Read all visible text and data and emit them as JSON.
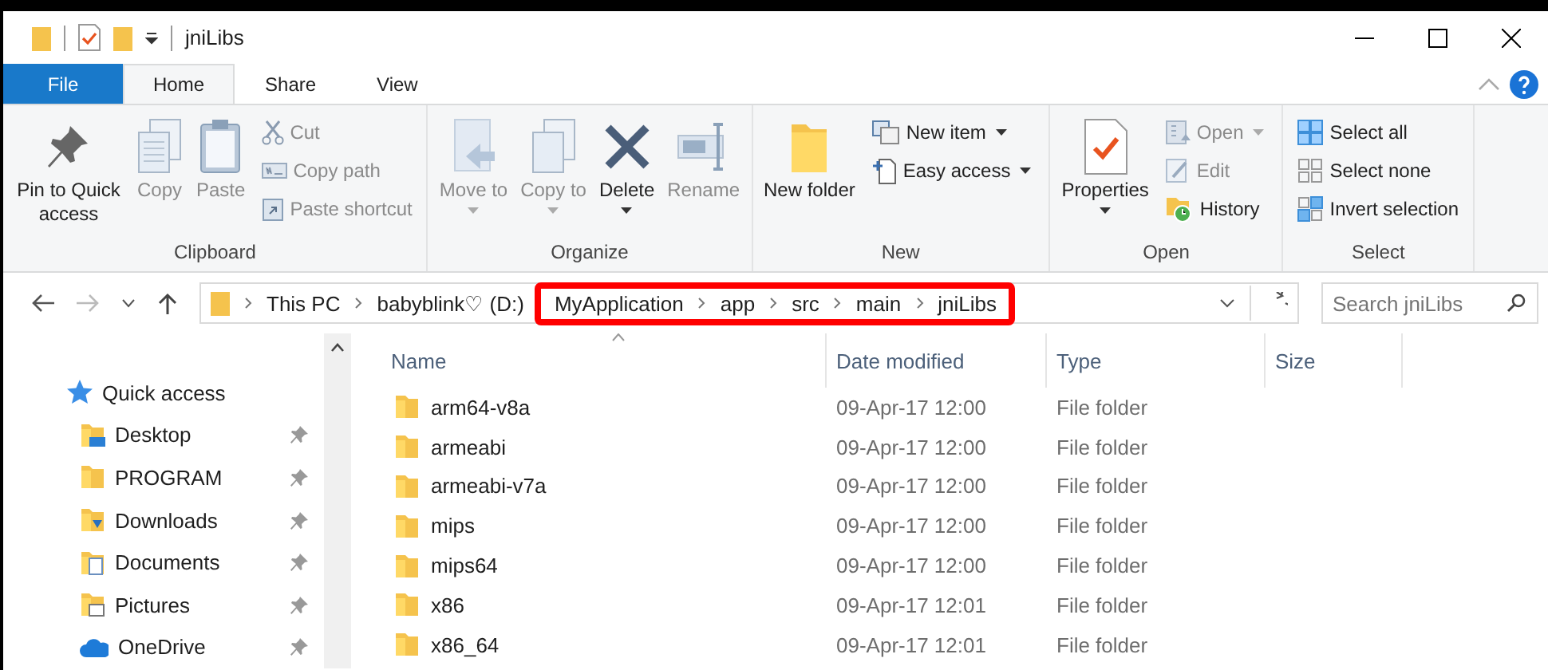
{
  "window": {
    "title": "jniLibs"
  },
  "ribbon_tabs": [
    {
      "label": "File",
      "kind": "file",
      "selected": false
    },
    {
      "label": "Home",
      "kind": "tab",
      "selected": true
    },
    {
      "label": "Share",
      "kind": "tab",
      "selected": false
    },
    {
      "label": "View",
      "kind": "tab",
      "selected": false
    }
  ],
  "ribbon_groups": [
    {
      "label": "Clipboard",
      "large": [
        {
          "label": "Pin to Quick access",
          "disabled": false,
          "dropdown": false
        },
        {
          "label": "Copy",
          "disabled": true,
          "dropdown": false
        },
        {
          "label": "Paste",
          "disabled": true,
          "dropdown": false
        }
      ],
      "small": [
        {
          "label": "Cut",
          "disabled": true,
          "dropdown": false
        },
        {
          "label": "Copy path",
          "disabled": true,
          "dropdown": false
        },
        {
          "label": "Paste shortcut",
          "disabled": true,
          "dropdown": false
        }
      ]
    },
    {
      "label": "Organize",
      "large": [
        {
          "label": "Move to",
          "disabled": true,
          "dropdown": true
        },
        {
          "label": "Copy to",
          "disabled": true,
          "dropdown": true
        },
        {
          "label": "Delete",
          "disabled": false,
          "dropdown": true
        },
        {
          "label": "Rename",
          "disabled": true,
          "dropdown": false
        }
      ]
    },
    {
      "label": "New",
      "large": [
        {
          "label": "New folder",
          "disabled": false,
          "dropdown": false
        }
      ],
      "small": [
        {
          "label": "New item",
          "disabled": false,
          "dropdown": true
        },
        {
          "label": "Easy access",
          "disabled": false,
          "dropdown": true
        }
      ]
    },
    {
      "label": "Open",
      "large": [
        {
          "label": "Properties",
          "disabled": false,
          "dropdown": true
        }
      ],
      "small": [
        {
          "label": "Open",
          "disabled": true,
          "dropdown": true
        },
        {
          "label": "Edit",
          "disabled": true,
          "dropdown": false
        },
        {
          "label": "History",
          "disabled": false,
          "dropdown": false
        }
      ]
    },
    {
      "label": "Select",
      "small": [
        {
          "label": "Select all",
          "disabled": false,
          "dropdown": false
        },
        {
          "label": "Select none",
          "disabled": false,
          "dropdown": false
        },
        {
          "label": "Invert selection",
          "disabled": false,
          "dropdown": false
        }
      ]
    }
  ],
  "address": {
    "segments": [
      {
        "label": "This PC",
        "highlighted": false
      },
      {
        "label": "babyblink♡ (D:)",
        "highlighted": false
      },
      {
        "label": "MyApplication",
        "highlighted": true
      },
      {
        "label": "app",
        "highlighted": true
      },
      {
        "label": "src",
        "highlighted": true
      },
      {
        "label": "main",
        "highlighted": true
      },
      {
        "label": "jniLibs",
        "highlighted": true
      }
    ]
  },
  "search": {
    "placeholder": "Search jniLibs"
  },
  "sidebar": {
    "items": [
      {
        "label": "Quick access",
        "kind": "header",
        "pinned": false
      },
      {
        "label": "Desktop",
        "kind": "item",
        "pinned": true
      },
      {
        "label": "PROGRAM",
        "kind": "item",
        "pinned": true
      },
      {
        "label": "Downloads",
        "kind": "item",
        "pinned": true
      },
      {
        "label": "Documents",
        "kind": "item",
        "pinned": true
      },
      {
        "label": "Pictures",
        "kind": "item",
        "pinned": true
      },
      {
        "label": "OneDrive",
        "kind": "item",
        "pinned": true
      }
    ]
  },
  "table": {
    "columns": [
      "Name",
      "Date modified",
      "Type",
      "Size"
    ],
    "rows": [
      {
        "name": "arm64-v8a",
        "date": "09-Apr-17 12:00",
        "type": "File folder"
      },
      {
        "name": "armeabi",
        "date": "09-Apr-17 12:00",
        "type": "File folder"
      },
      {
        "name": "armeabi-v7a",
        "date": "09-Apr-17 12:00",
        "type": "File folder"
      },
      {
        "name": "mips",
        "date": "09-Apr-17 12:00",
        "type": "File folder"
      },
      {
        "name": "mips64",
        "date": "09-Apr-17 12:00",
        "type": "File folder"
      },
      {
        "name": "x86",
        "date": "09-Apr-17 12:01",
        "type": "File folder"
      },
      {
        "name": "x86_64",
        "date": "09-Apr-17 12:01",
        "type": "File folder"
      }
    ]
  }
}
